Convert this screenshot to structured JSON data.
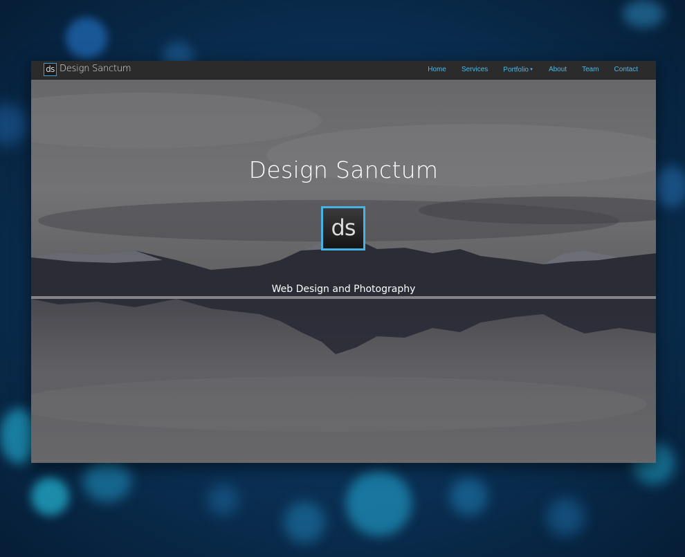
{
  "navbar": {
    "brand_logo": "ds",
    "brand_name": "Design Sanctum",
    "links": [
      "Home",
      "Services",
      "Portfolio",
      "About",
      "Team",
      "Contact"
    ]
  },
  "hero": {
    "title": "Design Sanctum",
    "logo_text": "ds",
    "tagline": "Web Design and Photography"
  },
  "colors": {
    "accent": "#4fb6e6",
    "navbar_bg": "#2b2b2b",
    "page_bg": "#0a2f52"
  },
  "icons": [
    "caret-down-icon",
    "bokeh-background"
  ]
}
